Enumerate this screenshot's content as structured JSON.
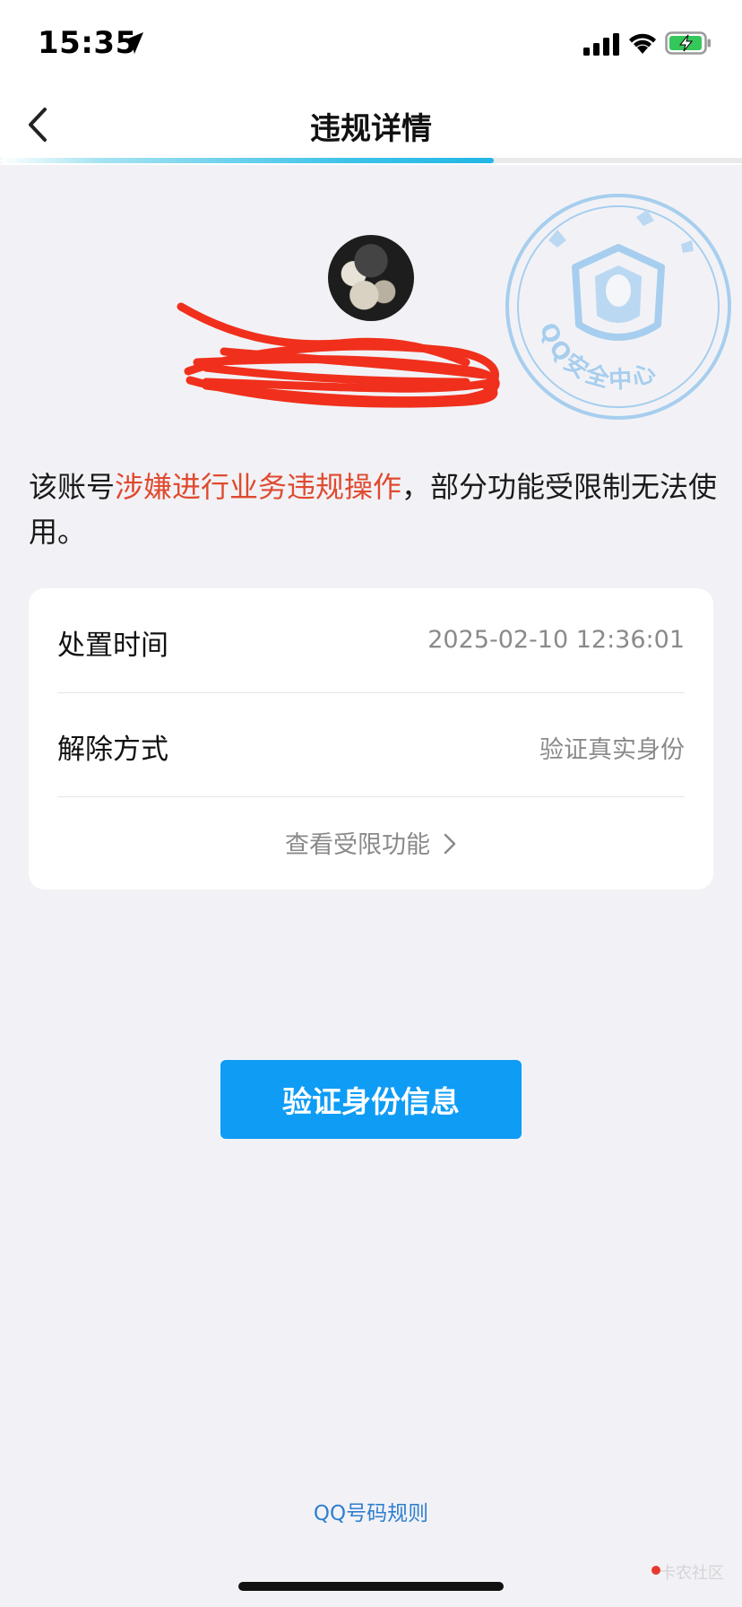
{
  "status_bar": {
    "time": "15:35"
  },
  "nav": {
    "title": "违规详情",
    "progress": 0.665
  },
  "notice": {
    "prefix": "该账号",
    "highlight": "涉嫌进行业务违规操作",
    "suffix": "，部分功能受限制无法使用。",
    "highlight_color": "#e04a2f"
  },
  "stamp": {
    "text": "QQ安全中心"
  },
  "details": {
    "rows": [
      {
        "label": "处置时间",
        "value": "2025-02-10 12:36:01"
      },
      {
        "label": "解除方式",
        "value": "验证真实身份"
      }
    ],
    "more_link": "查看受限功能"
  },
  "primary_button": {
    "label": "验证身份信息",
    "color": "#0e9cf5"
  },
  "footer": {
    "rules_link": "QQ号码规则",
    "watermark": "卡农社区"
  }
}
